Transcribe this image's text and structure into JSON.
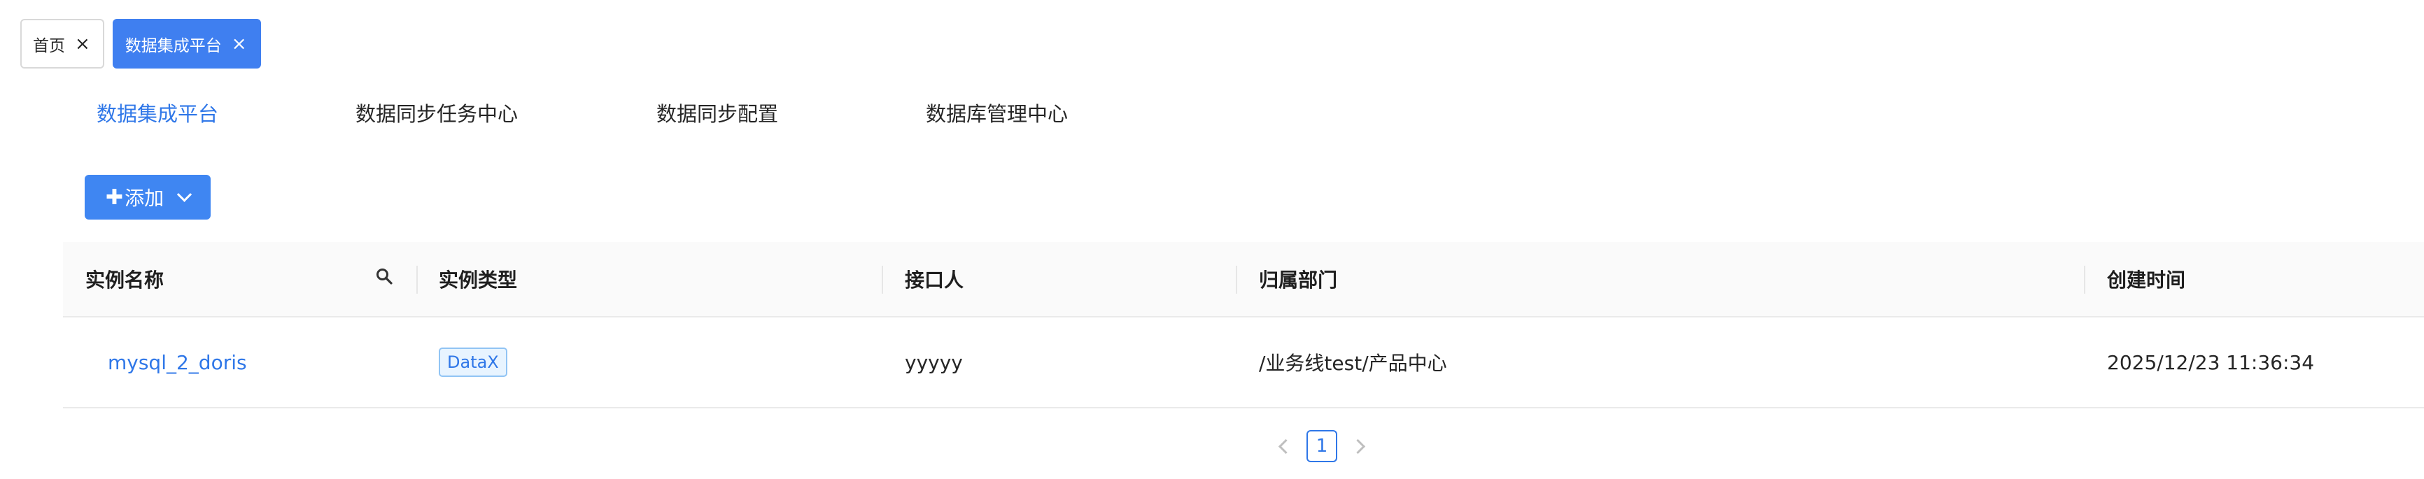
{
  "tabs": [
    {
      "label": "首页",
      "active": false
    },
    {
      "label": "数据集成平台",
      "active": true
    }
  ],
  "subnav": [
    {
      "label": "数据集成平台",
      "active": true
    },
    {
      "label": "数据同步任务中心",
      "active": false
    },
    {
      "label": "数据同步配置",
      "active": false
    },
    {
      "label": "数据库管理中心",
      "active": false
    }
  ],
  "add_button": {
    "plus": "✚",
    "label": "添加"
  },
  "table": {
    "columns": [
      "实例名称",
      "实例类型",
      "接口人",
      "归属部门",
      "创建时间"
    ],
    "rows": [
      {
        "name": "mysql_2_doris",
        "type": "DataX",
        "contact": "yyyyy",
        "department": "/业务线test/产品中心",
        "created": "2025/12/23 11:36:34"
      }
    ]
  },
  "pagination": {
    "current": "1"
  },
  "colors": {
    "primary": "#3f86f2",
    "link": "#2f77e8",
    "header_bg": "#fafafa"
  }
}
